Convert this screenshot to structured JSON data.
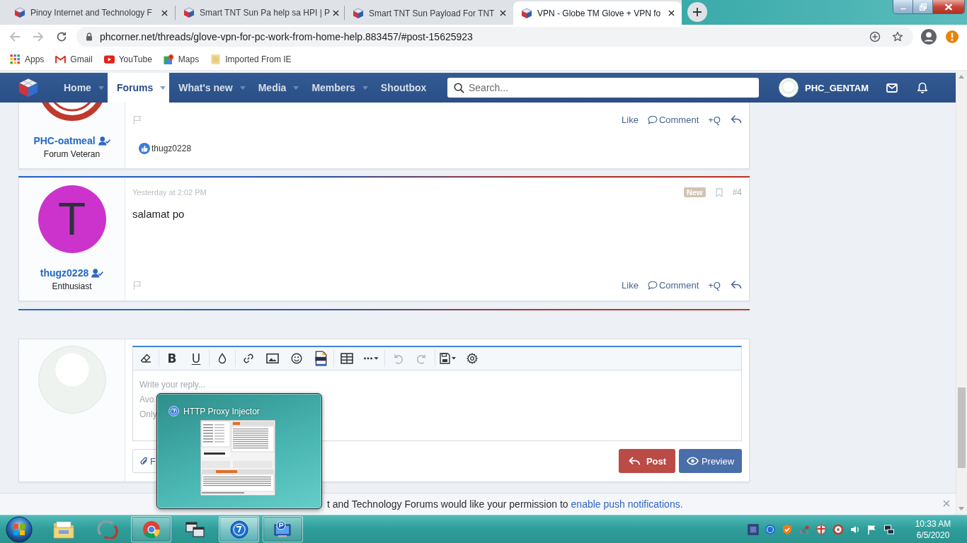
{
  "browser": {
    "tabs": [
      {
        "title": "Pinoy Internet and Technology F",
        "selected": false
      },
      {
        "title": "Smart TNT Sun Pa help sa HPI | P",
        "selected": false
      },
      {
        "title": "Smart TNT Sun Payload For TNT",
        "selected": false
      },
      {
        "title": "VPN - Globe TM Glove + VPN fo",
        "selected": true
      }
    ],
    "back_disabled": true,
    "forward_disabled": true,
    "url": "phcorner.net/threads/glove-vpn-for-pc-work-from-home-help.883457/#post-15625923",
    "bookmarks": [
      {
        "label": "Apps"
      },
      {
        "label": "Gmail"
      },
      {
        "label": "YouTube"
      },
      {
        "label": "Maps"
      },
      {
        "label": "Imported From IE"
      }
    ]
  },
  "nav": {
    "items": [
      {
        "label": "Home",
        "selected": false,
        "menu": true
      },
      {
        "label": "Forums",
        "selected": true,
        "menu": true
      },
      {
        "label": "What's new",
        "selected": false,
        "menu": true
      },
      {
        "label": "Media",
        "selected": false,
        "menu": true
      },
      {
        "label": "Members",
        "selected": false,
        "menu": true
      },
      {
        "label": "Shoutbox",
        "selected": false,
        "menu": false
      }
    ],
    "search": {
      "placeholder": "Search..."
    },
    "username": "PHC_GENTAM"
  },
  "posts": [
    {
      "avatar": {
        "kind": "logo"
      },
      "author": "PHC-oatmeal",
      "role": "Forum Veteran",
      "actions": [
        "Like",
        "Comment",
        "+Q"
      ],
      "reaction_user": "thugz0228"
    },
    {
      "avatar": {
        "kind": "letter",
        "letter": "T",
        "color": "#cc33cc"
      },
      "author": "thugz0228",
      "role": "Enthusiast",
      "date": "Yesterday at 2:02 PM",
      "badge": "New",
      "number": "#4",
      "body": "salamat po",
      "actions": [
        "Like",
        "Comment",
        "+Q"
      ]
    }
  ],
  "reply": {
    "toolbar": {
      "bold": "B",
      "underline": "U",
      "undo_disabled": true,
      "redo_disabled": true
    },
    "placeholder": [
      "Write your reply...",
      "Avo",
      "Only"
    ],
    "attach_label": "F",
    "post_button": "Post",
    "preview_button": "Preview"
  },
  "notice": {
    "text": "t and Technology Forums would like your permission to",
    "link": "enable push notifications."
  },
  "thumbnail_popup": {
    "title": "HTTP Proxy Injector"
  },
  "taskbar": {
    "apps": [
      {
        "running": false,
        "hovered": false
      },
      {
        "running": false,
        "hovered": false
      },
      {
        "running": true,
        "hovered": false
      },
      {
        "running": false,
        "hovered": false
      },
      {
        "running": true,
        "hovered": true
      },
      {
        "running": true,
        "hovered": false
      }
    ],
    "time": "10:33 AM",
    "date": "6/5/2020"
  }
}
